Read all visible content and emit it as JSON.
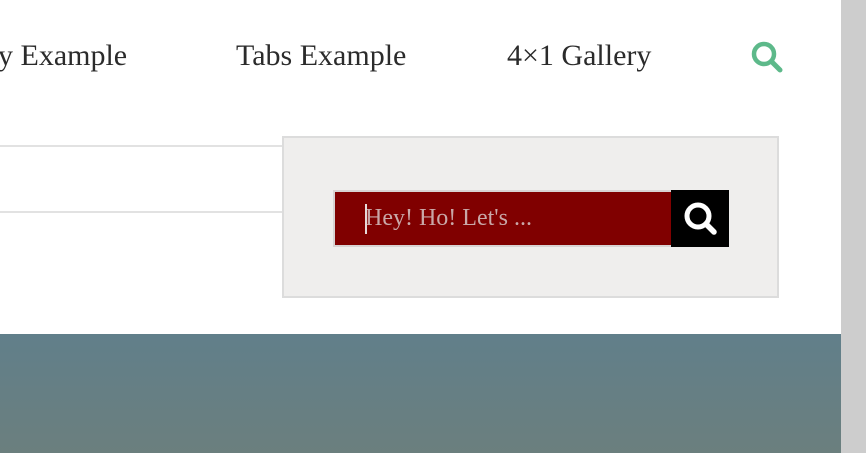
{
  "nav": {
    "items": [
      {
        "label": "ry Example"
      },
      {
        "label": "Tabs Example"
      },
      {
        "label": "4×1 Gallery"
      }
    ],
    "search_icon": "search-icon",
    "search_icon_color": "#5db98a"
  },
  "search": {
    "placeholder": "Hey! Ho! Let's ...",
    "value": "",
    "button_icon": "search-icon",
    "input_bg": "#800000",
    "button_bg": "#000000"
  },
  "colors": {
    "panel_bg": "#efeeed",
    "banner": "#627f89"
  }
}
